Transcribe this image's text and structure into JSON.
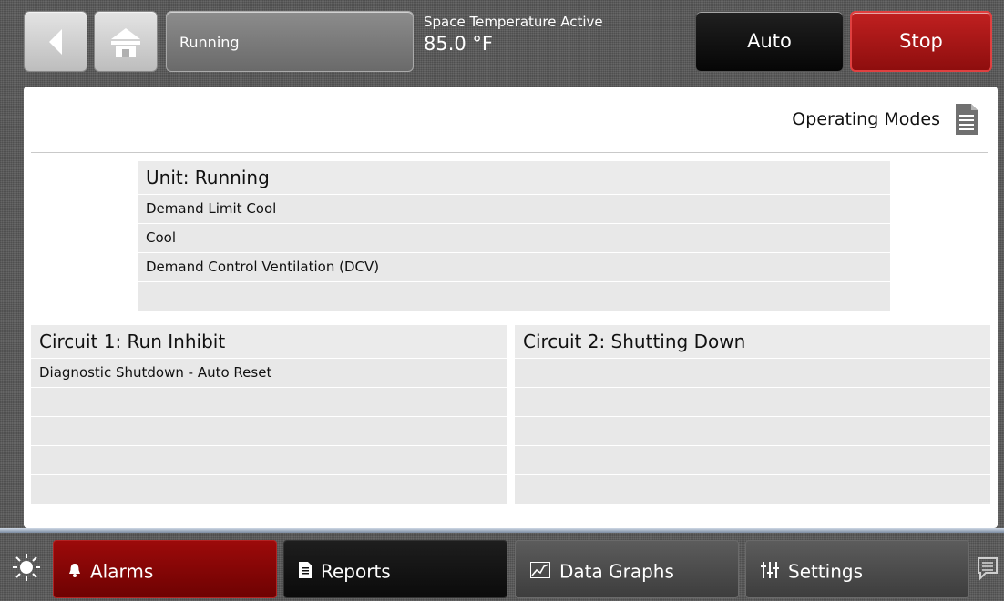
{
  "header": {
    "status": "Running",
    "space_temp_label": "Space Temperature Active",
    "space_temp_value": "85.0 °F",
    "auto_label": "Auto",
    "stop_label": "Stop"
  },
  "panel": {
    "title": "Operating Modes"
  },
  "unit": {
    "heading": "Unit:  Running",
    "rows": [
      "Demand Limit Cool",
      "Cool",
      "Demand Control Ventilation (DCV)",
      ""
    ]
  },
  "circuit1": {
    "heading": "Circuit 1:  Run Inhibit",
    "rows": [
      "Diagnostic Shutdown - Auto Reset",
      "",
      "",
      "",
      ""
    ]
  },
  "circuit2": {
    "heading": "Circuit 2:  Shutting Down",
    "rows": [
      "",
      "",
      "",
      "",
      ""
    ]
  },
  "nav": {
    "alarms": "Alarms",
    "reports": "Reports",
    "data_graphs": "Data Graphs",
    "settings": "Settings"
  },
  "colors": {
    "stop": "#b01515",
    "alarms": "#8a0606",
    "auto": "#101010"
  },
  "icons": [
    "back-arrow-icon",
    "home-icon",
    "document-icon",
    "sun-icon",
    "bell-icon",
    "report-icon",
    "graph-icon",
    "sliders-icon",
    "chat-icon"
  ]
}
